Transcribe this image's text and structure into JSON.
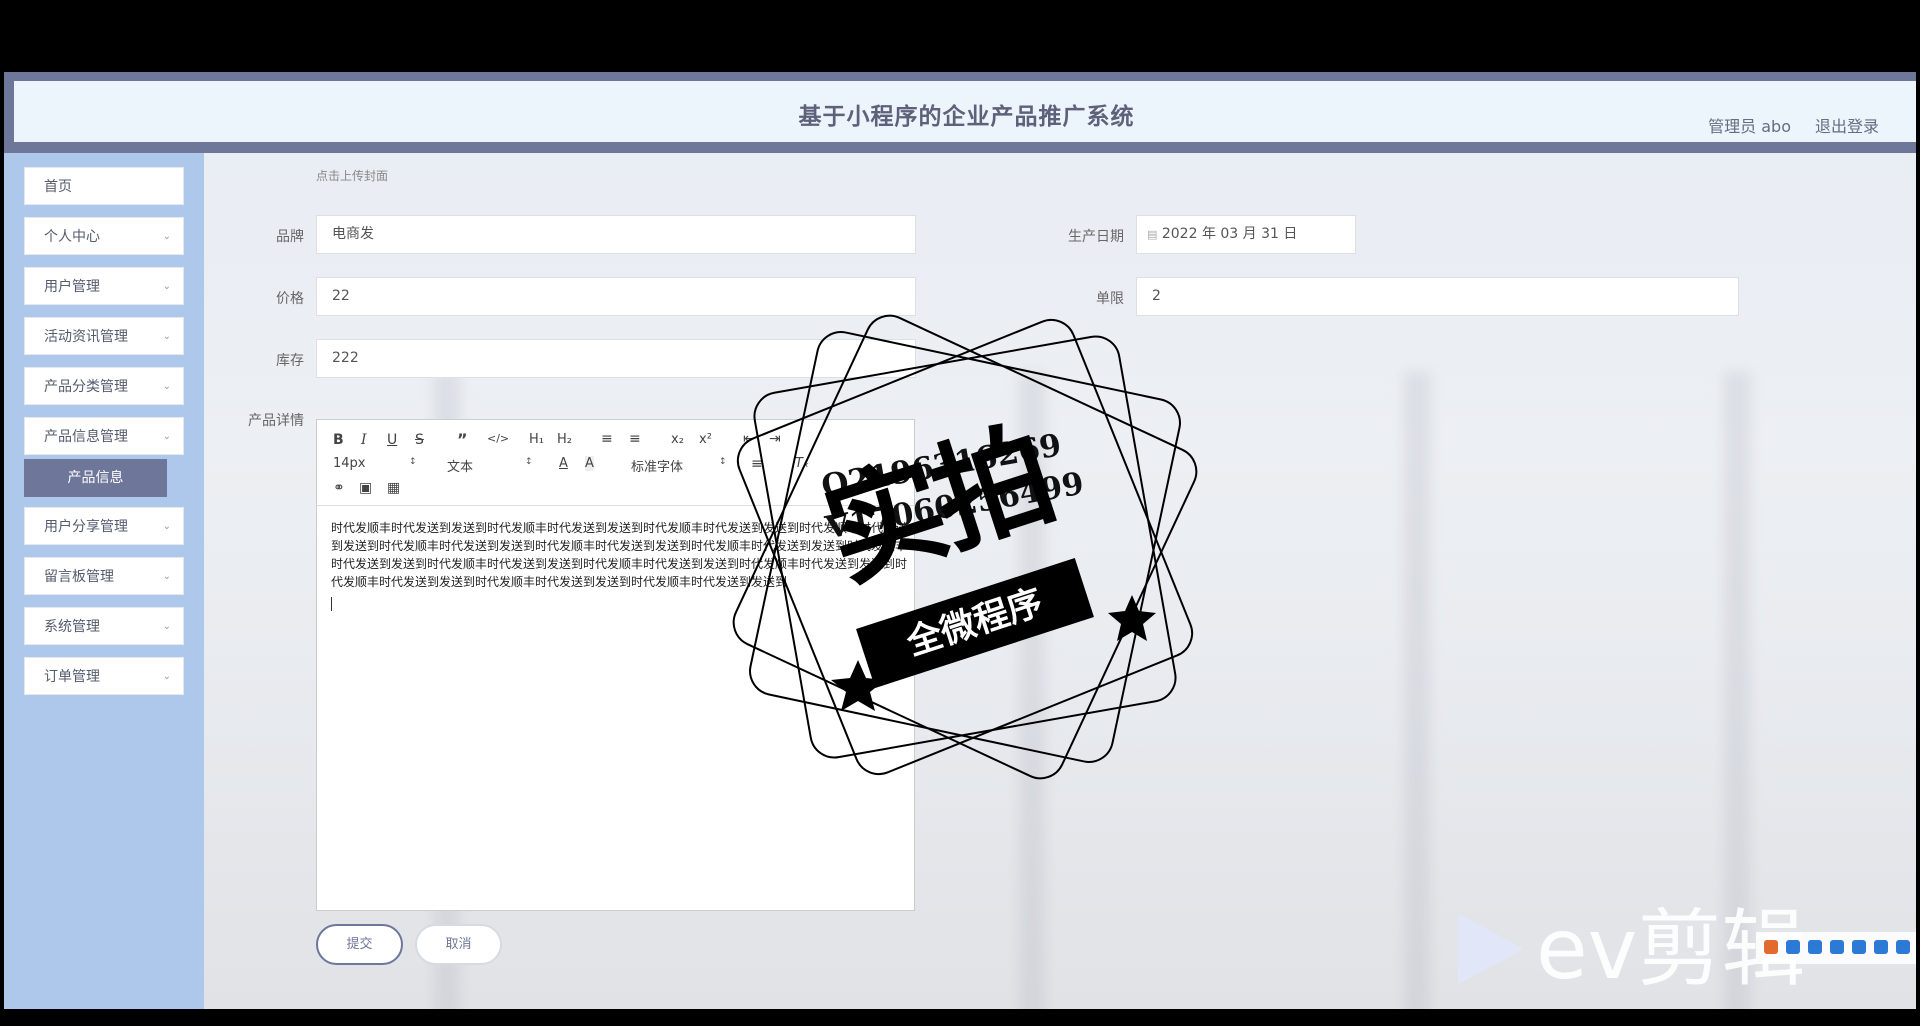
{
  "header": {
    "title": "基于小程序的企业产品推广系统",
    "admin_label": "管理员 abo",
    "logout_label": "退出登录"
  },
  "sidebar": {
    "items": [
      {
        "label": "首页"
      },
      {
        "label": "个人中心"
      },
      {
        "label": "用户管理"
      },
      {
        "label": "活动资讯管理"
      },
      {
        "label": "产品分类管理"
      },
      {
        "label": "产品信息管理"
      },
      {
        "label": "用户分享管理"
      },
      {
        "label": "留言板管理"
      },
      {
        "label": "系统管理"
      },
      {
        "label": "订单管理"
      }
    ],
    "active_sub": "产品信息",
    "chevron": "chevron-down-icon"
  },
  "form": {
    "cover_hint": "点击上传封面",
    "brand_label": "品牌",
    "brand_value": "电商发",
    "production_date_label": "生产日期",
    "production_date_value": "2022 年 03 月 31 日",
    "price_label": "价格",
    "price_value": "22",
    "period_label": "单限",
    "period_value": "2",
    "stock_label": "库存",
    "stock_value": "222",
    "detail_label": "产品详情"
  },
  "editor": {
    "font_size": "14px",
    "text_type": "文本",
    "font_family": "标准字体",
    "content": "时代发顺丰时代发送到发送到时代发顺丰时代发送到发送到时代发顺丰时代发送到发送到时代发顺丰时代发送到发送到时代发顺丰时代发送到发送到时代发顺丰时代发送到发送到时代发顺丰时代发送到发送到时代发顺丰时代发送到发送到时代发顺丰时代发送到发送到时代发顺丰时代发送到发送到时代发顺丰时代发送到发送到时代发顺丰时代发送到发送到时代发顺丰时代发送到发送到时代发顺丰时代发送到发送到"
  },
  "actions": {
    "submit_label": "提交",
    "cancel_label": "取消"
  },
  "stamp": {
    "line1": "Q2196316269",
    "line2": "V17060256499",
    "big": "实拍",
    "banner": "全微程序"
  },
  "watermark": {
    "text": "ev剪辑"
  },
  "colors": {
    "primary": "#6e7699",
    "sidebar_bg": "#aec8ec",
    "header_bg": "#ecf4fc"
  }
}
